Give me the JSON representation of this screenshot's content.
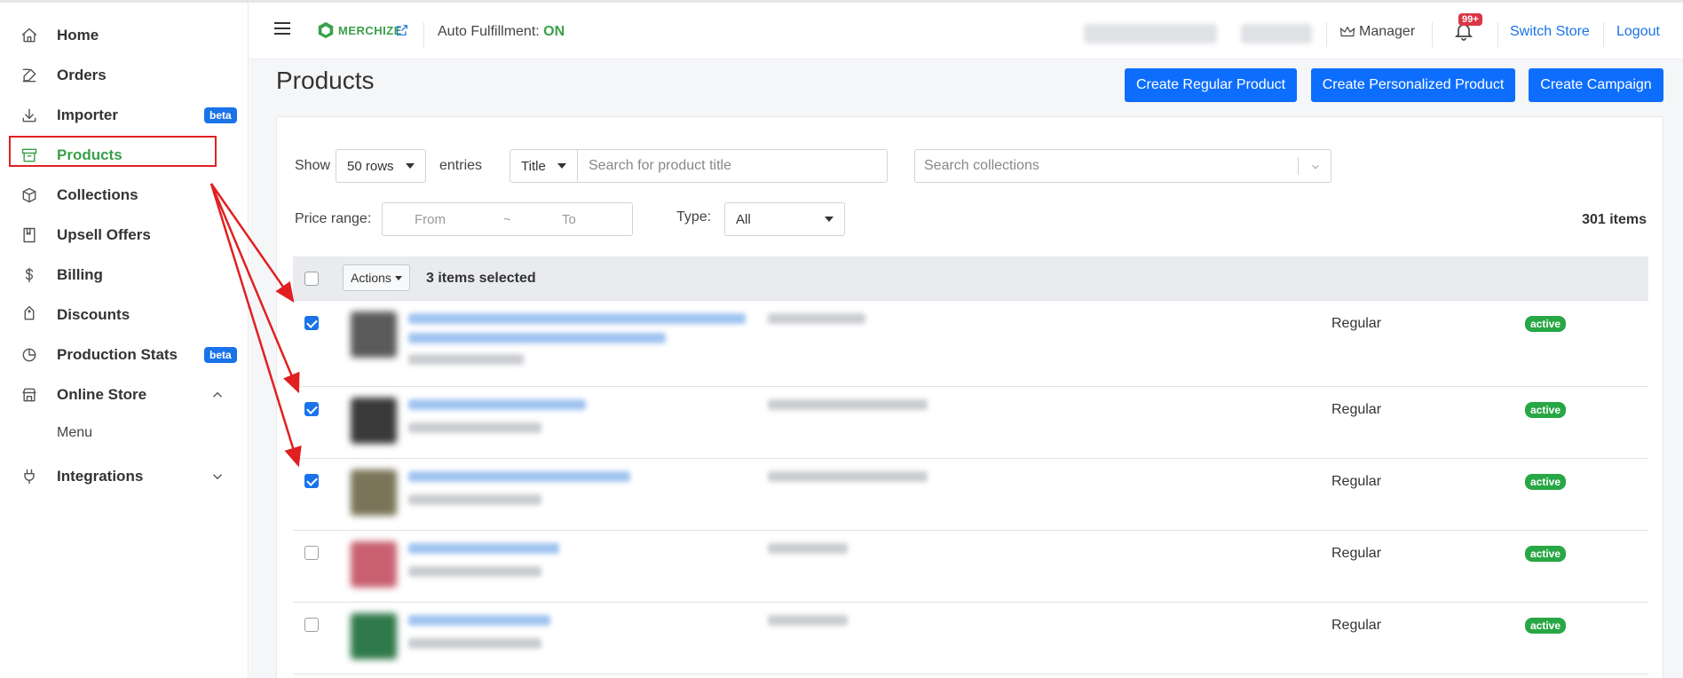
{
  "sidebar": {
    "items": [
      {
        "label": "Home",
        "icon": "home-icon"
      },
      {
        "label": "Orders",
        "icon": "edit-icon"
      },
      {
        "label": "Importer",
        "icon": "download-icon",
        "badge": "beta"
      },
      {
        "label": "Products",
        "icon": "archive-icon",
        "active": true
      },
      {
        "label": "Collections",
        "icon": "box-icon"
      },
      {
        "label": "Upsell Offers",
        "icon": "book-icon"
      },
      {
        "label": "Billing",
        "icon": "dollar-icon"
      },
      {
        "label": "Discounts",
        "icon": "tag-icon"
      },
      {
        "label": "Production Stats",
        "icon": "pie-chart-icon",
        "badge": "beta"
      },
      {
        "label": "Online Store",
        "icon": "store-icon"
      },
      {
        "label": "Integrations",
        "icon": "plug-icon"
      }
    ],
    "submenu": {
      "label": "Menu"
    }
  },
  "topbar": {
    "brand": "MERCHIZE",
    "auto_fulfillment_label": "Auto Fulfillment:",
    "auto_fulfillment_value": "ON",
    "manager": "Manager",
    "notifications": "99+",
    "switch_store": "Switch Store",
    "logout": "Logout"
  },
  "page": {
    "title": "Products",
    "buttons": {
      "create_regular": "Create Regular Product",
      "create_personalized": "Create Personalized Product",
      "create_campaign": "Create Campaign"
    }
  },
  "filters": {
    "show_label": "Show",
    "rows_value": "50 rows",
    "entries_label": "entries",
    "field_value": "Title",
    "search_placeholder": "Search for product title",
    "collections_placeholder": "Search collections",
    "price_label": "Price range:",
    "price_from": "From",
    "price_sep": "~",
    "price_to": "To",
    "type_label": "Type:",
    "type_value": "All",
    "items_count": "301 items"
  },
  "table": {
    "actions_label": "Actions",
    "selected_text": "3 items selected",
    "rows": [
      {
        "checked": true,
        "type": "Regular",
        "status": "active",
        "thumb_color": "#5a5a5a"
      },
      {
        "checked": true,
        "type": "Regular",
        "status": "active",
        "thumb_color": "#3a3a3a"
      },
      {
        "checked": true,
        "type": "Regular",
        "status": "active",
        "thumb_color": "#7a7558"
      },
      {
        "checked": false,
        "type": "Regular",
        "status": "active",
        "thumb_color": "#c86070"
      },
      {
        "checked": false,
        "type": "Regular",
        "status": "active",
        "thumb_color": "#2f7a4a"
      }
    ]
  },
  "colors": {
    "accent_green": "#3aa04a",
    "primary_blue": "#0d6efd",
    "annotation_red": "#e02020",
    "status_green": "#28a745"
  }
}
